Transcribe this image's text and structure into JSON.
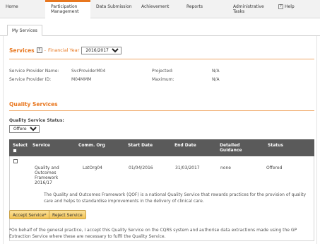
{
  "nav": {
    "home": "Home",
    "participation_line1": "Participation",
    "participation_line2": "Management",
    "data_submission": "Data Submission",
    "achievement": "Achievement",
    "reports": "Reports",
    "admin_line1": "Administrative",
    "admin_line2": "Tasks",
    "help_icon": "?",
    "help": "Help"
  },
  "subtabs": {
    "my_services": "My Services"
  },
  "services": {
    "title": "Services",
    "help_icon": "?",
    "dash": "-",
    "financial_year_label": "Financial Year",
    "financial_year_value": "2016/2017",
    "provider_name_label": "Service Provider Name:",
    "provider_name_value": "SvcProviderM04",
    "provider_id_label": "Service Provider ID:",
    "provider_id_value": "M04MMM",
    "projected_label": "Projected:",
    "projected_value": "N/A",
    "maximum_label": "Maximum:",
    "maximum_value": "N/A"
  },
  "quality": {
    "title": "Quality Services",
    "status_label": "Quality Service Status:",
    "status_value": "Offered"
  },
  "table": {
    "headers": {
      "select": "Select",
      "service": "Service",
      "comm_org": "Comm. Org",
      "start_date": "Start Date",
      "end_date": "End Date",
      "detailed_line1": "Detailed",
      "detailed_line2": "Guidance",
      "status": "Status"
    },
    "row": {
      "service_line1": "Quality and",
      "service_line2": "Outcomes",
      "service_line3": "Framework",
      "service_line4": "2016/17",
      "comm_org": "LatOrg04",
      "start_date": "01/04/2016",
      "end_date": "31/03/2017",
      "guidance": "none",
      "status": "Offered",
      "description": "The Quality and Outcomes Framework (QOF) is a national Quality Service that rewards practices for the provision of quality care and helps to standardise improvements in the delivery of clinical care."
    }
  },
  "buttons": {
    "accept": "Accept Service*",
    "reject": "Reject Service"
  },
  "footnote": "*On behalf of the general practice, I accept this Quality Service on the CQRS system and authorise data extractions made using the GP Extraction Service where these are necessary to fulfil the Quality Service.",
  "colors": {
    "accent": "#e8771f",
    "header_bg": "#5a5a5a",
    "button": "#f4c453"
  }
}
